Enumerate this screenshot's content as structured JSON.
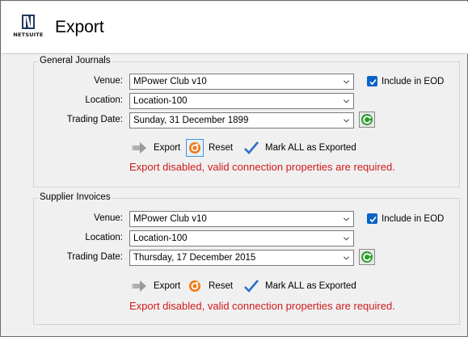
{
  "header": {
    "logo_text": "NETSUITE",
    "title": "Export"
  },
  "sections": [
    {
      "legend": "General Journals",
      "venue_label": "Venue:",
      "venue_value": "MPower Club v10",
      "include_eod_label": "Include in EOD",
      "include_eod_checked": true,
      "location_label": "Location:",
      "location_value": "Location-100",
      "trading_date_label": "Trading Date:",
      "trading_date_value": "Sunday, 31 December 1899",
      "export_label": "Export",
      "reset_label": "Reset",
      "mark_label": "Mark ALL as Exported",
      "error_text": "Export disabled, valid connection properties are required."
    },
    {
      "legend": "Supplier Invoices",
      "venue_label": "Venue:",
      "venue_value": "MPower Club v10",
      "include_eod_label": "Include in EOD",
      "include_eod_checked": true,
      "location_label": "Location:",
      "location_value": "Location-100",
      "trading_date_label": "Trading Date:",
      "trading_date_value": "Thursday, 17 December 2015",
      "export_label": "Export",
      "reset_label": "Reset",
      "mark_label": "Mark ALL as Exported",
      "error_text": "Export disabled, valid connection properties are required."
    }
  ],
  "colors": {
    "error": "#d11a1a",
    "checkbox": "#0a64c8",
    "refresh_green": "#2e9e2e",
    "reset_orange": "#f07a14"
  }
}
